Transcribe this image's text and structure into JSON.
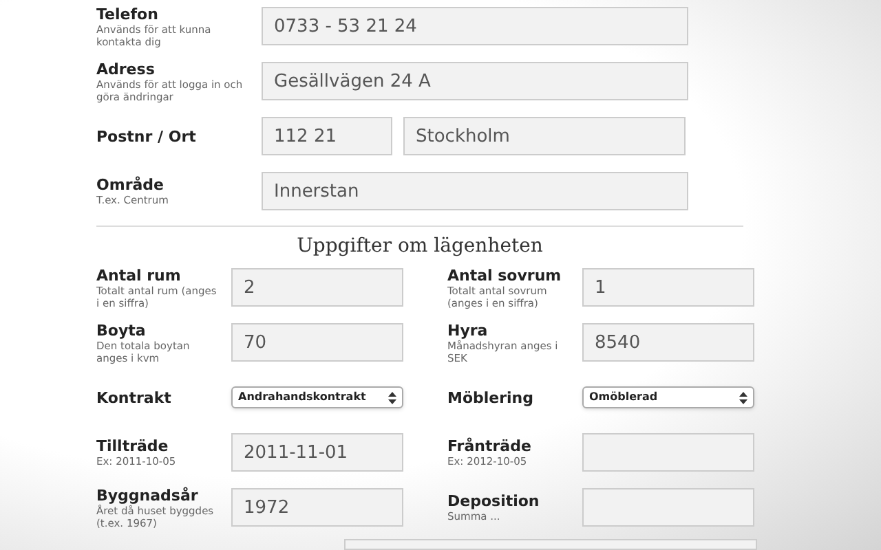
{
  "contact_fields": [
    {
      "kind": "text",
      "label": "Telefon",
      "hint": "Används för att kunna kontakta dig",
      "value": "0733 - 53 21 24"
    },
    {
      "kind": "text",
      "label": "Adress",
      "hint": "Används för att logga in och göra ändringar",
      "value": "Gesällvägen 24 A"
    },
    {
      "kind": "pair",
      "label": "Postnr / Ort",
      "values": [
        "112 21",
        "Stockholm"
      ]
    },
    {
      "kind": "text",
      "label": "Område",
      "hint": "T.ex. Centrum",
      "value": "Innerstan"
    }
  ],
  "section_heading": "Uppgifter om lägenheten",
  "left_fields": [
    {
      "kind": "text",
      "label": "Antal rum",
      "hint": "Totalt antal rum (anges i en siffra)",
      "value": "2"
    },
    {
      "kind": "text",
      "label": "Boyta",
      "hint": "Den totala boytan anges i kvm",
      "value": "70"
    },
    {
      "kind": "select",
      "label": "Kontrakt",
      "value": "Andrahandskontrakt"
    },
    {
      "kind": "text",
      "label": "Tillträde",
      "hint": "Ex: 2011-10-05",
      "value": "2011-11-01"
    },
    {
      "kind": "text",
      "label": "Byggnadsår",
      "hint": "Året då huset byggdes (t.ex. 1967)",
      "value": "1972"
    }
  ],
  "right_fields": [
    {
      "kind": "text",
      "label": "Antal sovrum",
      "hint": "Totalt antal sovrum (anges i en siffra)",
      "value": "1"
    },
    {
      "kind": "text",
      "label": "Hyra",
      "hint": "Månadshyran anges i SEK",
      "value": "8540"
    },
    {
      "kind": "select",
      "label": "Möblering",
      "value": "Omöblerad"
    },
    {
      "kind": "text",
      "label": "Frånträde",
      "hint": "Ex: 2012-10-05"
    },
    {
      "kind": "text",
      "label": "Deposition",
      "hint": "Summa ..."
    }
  ]
}
